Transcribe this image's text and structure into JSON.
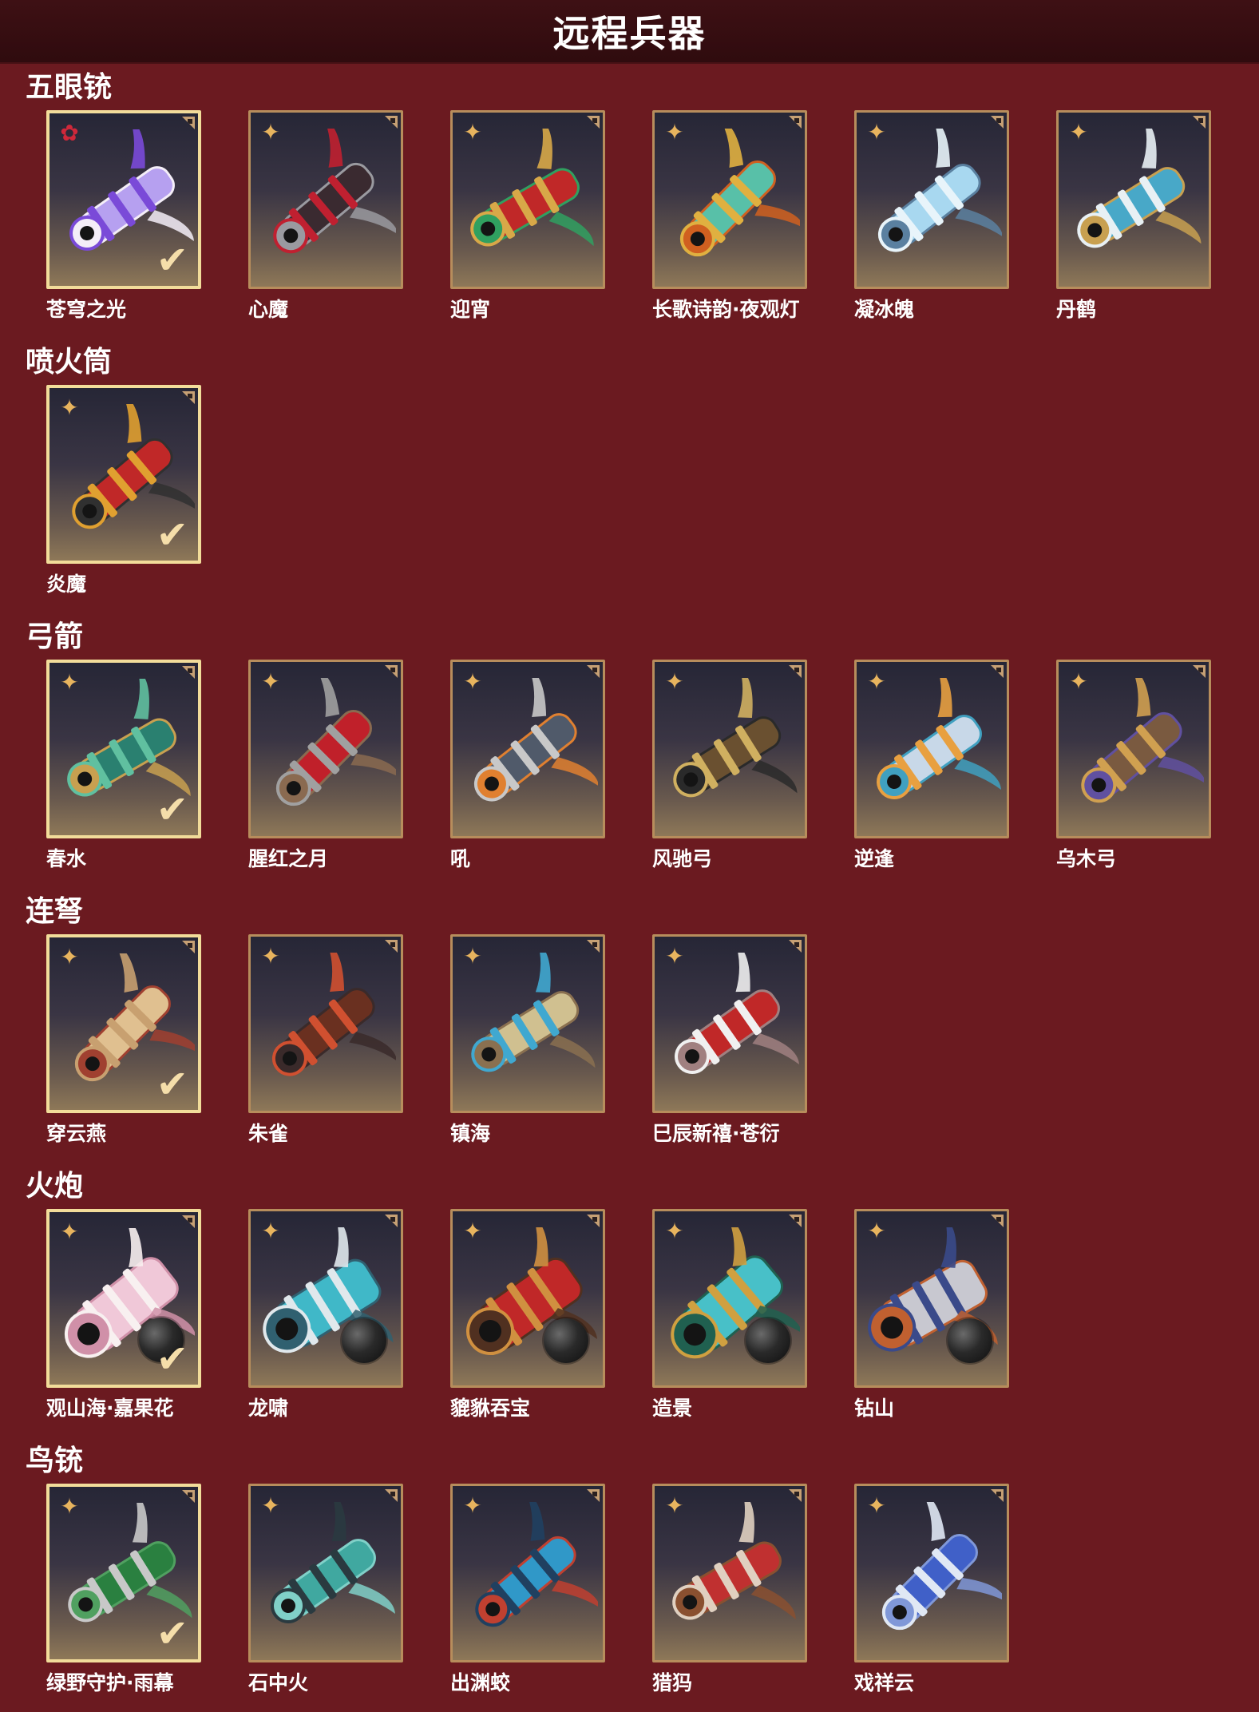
{
  "header": {
    "title": "远程兵器"
  },
  "colors": {
    "background": "#6b1a20",
    "header": "#2f0b0e",
    "tile_border": "#b78d5c",
    "selected_border": "#f2dc9a",
    "rank_icon_gold": "#e8b45e",
    "rank_icon_red": "#d0283a",
    "check": "#f5deaa"
  },
  "sections": [
    {
      "title": "五眼铳",
      "items": [
        {
          "name": "苍穹之光",
          "selected": true,
          "rank_icon": "red-flower-icon",
          "palette": [
            "#b6a0f0",
            "#7a4ad8",
            "#f4eef8"
          ]
        },
        {
          "name": "心魔",
          "selected": false,
          "rank_icon": "gold-star-icon",
          "palette": [
            "#3a2a30",
            "#c02030",
            "#9a9aa0"
          ]
        },
        {
          "name": "迎宵",
          "selected": false,
          "rank_icon": "gold-star-icon",
          "palette": [
            "#c02828",
            "#d8a848",
            "#30a060"
          ]
        },
        {
          "name": "长歌诗韵·夜观灯",
          "selected": false,
          "rank_icon": "gold-star-icon",
          "palette": [
            "#58c0a8",
            "#e0b040",
            "#d06020"
          ]
        },
        {
          "name": "凝冰魄",
          "selected": false,
          "rank_icon": "gold-star-icon",
          "palette": [
            "#a8d8f0",
            "#e8f4fa",
            "#5a80a0"
          ]
        },
        {
          "name": "丹鹤",
          "selected": false,
          "rank_icon": "gold-star-icon",
          "palette": [
            "#48a8c8",
            "#e8f0f4",
            "#c8a050"
          ]
        }
      ]
    },
    {
      "title": "喷火筒",
      "items": [
        {
          "name": "炎魔",
          "selected": true,
          "rank_icon": "gold-star-icon",
          "palette": [
            "#c02828",
            "#e0a030",
            "#303030"
          ]
        }
      ]
    },
    {
      "title": "弓箭",
      "items": [
        {
          "name": "春水",
          "selected": true,
          "rank_icon": "gold-star-icon",
          "palette": [
            "#2a8070",
            "#60c0a0",
            "#c8a050"
          ]
        },
        {
          "name": "腥红之月",
          "selected": false,
          "rank_icon": "gold-star-icon",
          "palette": [
            "#c0202a",
            "#a0a0a0",
            "#8a6a50"
          ]
        },
        {
          "name": "吼",
          "selected": false,
          "rank_icon": "gold-star-icon",
          "palette": [
            "#505a6a",
            "#c8c8c8",
            "#e08030"
          ]
        },
        {
          "name": "风驰弓",
          "selected": false,
          "rank_icon": "gold-star-icon",
          "palette": [
            "#6a5030",
            "#d0b060",
            "#2a2a2a"
          ]
        },
        {
          "name": "逆逢",
          "selected": false,
          "rank_icon": "gold-star-icon",
          "palette": [
            "#c8d8e8",
            "#e8a040",
            "#40a0c0"
          ]
        },
        {
          "name": "乌木弓",
          "selected": false,
          "rank_icon": "gold-star-icon",
          "palette": [
            "#7a5a40",
            "#d0a050",
            "#6050a0"
          ]
        }
      ]
    },
    {
      "title": "连弩",
      "items": [
        {
          "name": "穿云燕",
          "selected": true,
          "rank_icon": "gold-star-icon",
          "palette": [
            "#e0c090",
            "#c8a070",
            "#a04030"
          ]
        },
        {
          "name": "朱雀",
          "selected": false,
          "rank_icon": "gold-star-icon",
          "palette": [
            "#6a3020",
            "#d05030",
            "#3a2a2a"
          ]
        },
        {
          "name": "镇海",
          "selected": false,
          "rank_icon": "gold-star-icon",
          "palette": [
            "#d0c090",
            "#40a8d0",
            "#8a7050"
          ]
        },
        {
          "name": "巳辰新禧·苍衍",
          "selected": false,
          "rank_icon": "gold-star-icon",
          "palette": [
            "#c02828",
            "#f0f0f0",
            "#a08080"
          ]
        }
      ]
    },
    {
      "title": "火炮",
      "items": [
        {
          "name": "观山海·嘉果花",
          "selected": true,
          "rank_icon": "gold-star-icon",
          "palette": [
            "#f0c8d8",
            "#f8f0f0",
            "#d090a8"
          ]
        },
        {
          "name": "龙啸",
          "selected": false,
          "rank_icon": "gold-star-icon",
          "palette": [
            "#40b8c8",
            "#e0e8ec",
            "#306070"
          ]
        },
        {
          "name": "貔貅吞宝",
          "selected": false,
          "rank_icon": "gold-star-icon",
          "palette": [
            "#c02828",
            "#d09040",
            "#503020"
          ]
        },
        {
          "name": "造景",
          "selected": false,
          "rank_icon": "gold-star-icon",
          "palette": [
            "#48c0c8",
            "#d0a040",
            "#206050"
          ]
        },
        {
          "name": "钻山",
          "selected": false,
          "rank_icon": "gold-star-icon",
          "palette": [
            "#c8c8d0",
            "#3a4a8a",
            "#c06030"
          ]
        }
      ]
    },
    {
      "title": "鸟铳",
      "items": [
        {
          "name": "绿野守护·雨幕",
          "selected": true,
          "rank_icon": "gold-star-icon",
          "palette": [
            "#2a8040",
            "#c8c8c8",
            "#50a060"
          ]
        },
        {
          "name": "石中火",
          "selected": false,
          "rank_icon": "gold-star-icon",
          "palette": [
            "#40a8a0",
            "#2a3a40",
            "#80d0c8"
          ]
        },
        {
          "name": "出渊蛟",
          "selected": false,
          "rank_icon": "gold-star-icon",
          "palette": [
            "#3098c8",
            "#204060",
            "#c04030"
          ]
        },
        {
          "name": "猎犸",
          "selected": false,
          "rank_icon": "gold-star-icon",
          "palette": [
            "#c03030",
            "#e0d0c0",
            "#8a5030"
          ]
        },
        {
          "name": "戏祥云",
          "selected": false,
          "rank_icon": "gold-star-icon",
          "palette": [
            "#4060c8",
            "#e0e8f4",
            "#8098d8"
          ]
        }
      ]
    }
  ]
}
